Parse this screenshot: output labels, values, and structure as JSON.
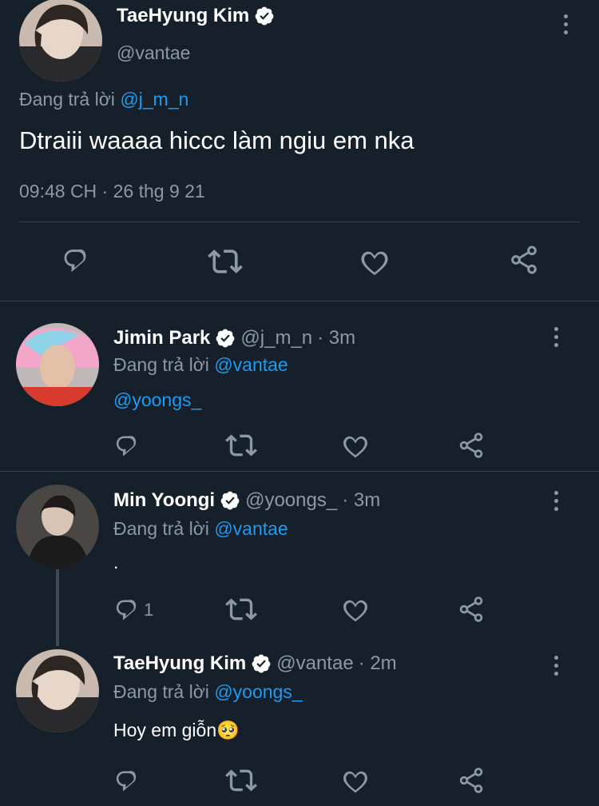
{
  "main_tweet": {
    "name": "TaeHyung Kim",
    "handle": "@vantae",
    "replying_prefix": "Đang trả lời",
    "replying_to": "@j_m_n",
    "text": "Dtraiii waaaa hiccc làm ngiu em nka",
    "timestamp": "09:48 CH · 26 thg 9 21"
  },
  "replies": [
    {
      "name": "Jimin Park",
      "handle": "@j_m_n",
      "time": "· 3m",
      "replying_prefix": "Đang trả lời",
      "replying_to": "@vantae",
      "text": "@yoongs_",
      "reply_count": ""
    },
    {
      "name": "Min Yoongi",
      "handle": "@yoongs_",
      "time": "· 3m",
      "replying_prefix": "Đang trả lời",
      "replying_to": "@vantae",
      "text": ".",
      "reply_count": "1"
    },
    {
      "name": "TaeHyung Kim",
      "handle": "@vantae",
      "time": "· 2m",
      "replying_prefix": "Đang trả lời",
      "replying_to": "@yoongs_",
      "text": "Hoy em giỗn",
      "emoji": "🥺",
      "reply_count": ""
    }
  ],
  "icons": [
    "reply-icon",
    "retweet-icon",
    "like-icon",
    "share-icon",
    "more-icon",
    "verified-icon"
  ],
  "colors": {
    "background": "#15202b",
    "link": "#1d9bf0",
    "muted": "#8b98a5",
    "divider": "#38444d"
  }
}
